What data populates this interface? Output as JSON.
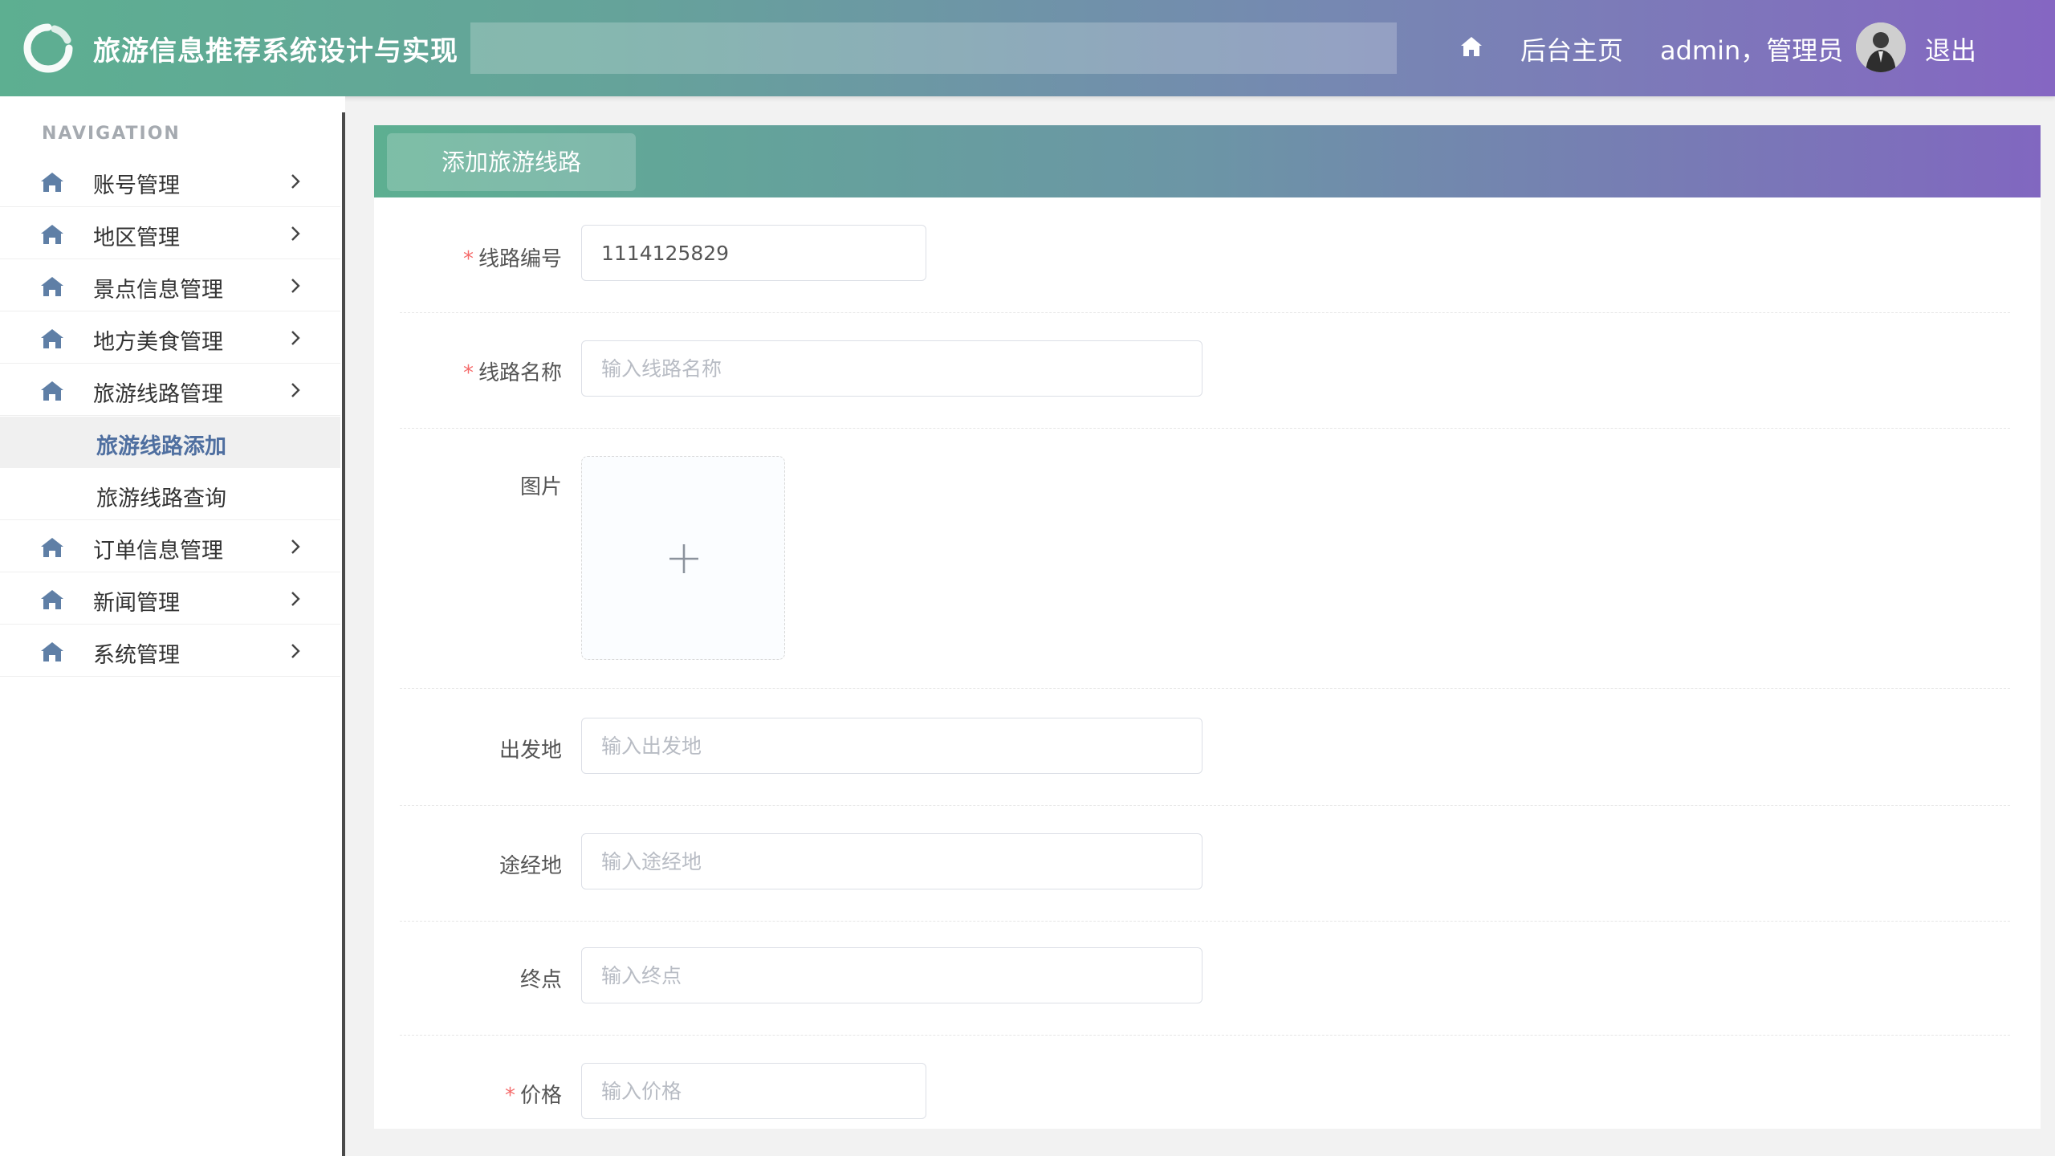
{
  "header": {
    "title": "旅游信息推荐系统设计与实现",
    "backend_link": "后台主页",
    "user_label": "admin，管理员",
    "logout": "退出"
  },
  "sidebar": {
    "heading": "NAVIGATION",
    "items": [
      {
        "label": "账号管理"
      },
      {
        "label": "地区管理"
      },
      {
        "label": "景点信息管理"
      },
      {
        "label": "地方美食管理"
      },
      {
        "label": "旅游线路管理"
      }
    ],
    "sub_items": [
      {
        "label": "旅游线路添加",
        "active": true
      },
      {
        "label": "旅游线路查询",
        "active": false
      }
    ],
    "items_after": [
      {
        "label": "订单信息管理"
      },
      {
        "label": "新闻管理"
      },
      {
        "label": "系统管理"
      }
    ]
  },
  "panel": {
    "tab": "添加旅游线路"
  },
  "form": {
    "route_no": {
      "label": "线路编号",
      "value": "1114125829",
      "required": true
    },
    "route_name": {
      "label": "线路名称",
      "placeholder": "输入线路名称",
      "required": true
    },
    "image": {
      "label": "图片"
    },
    "departure": {
      "label": "出发地",
      "placeholder": "输入出发地"
    },
    "via": {
      "label": "途经地",
      "placeholder": "输入途经地"
    },
    "destination": {
      "label": "终点",
      "placeholder": "输入终点"
    },
    "price": {
      "label": "价格",
      "placeholder": "输入价格",
      "required": true
    }
  },
  "colors": {
    "gradient_start": "#5daf91",
    "gradient_end": "#8566c2",
    "active_nav": "#4f6fa0",
    "required": "#f56c6c"
  }
}
